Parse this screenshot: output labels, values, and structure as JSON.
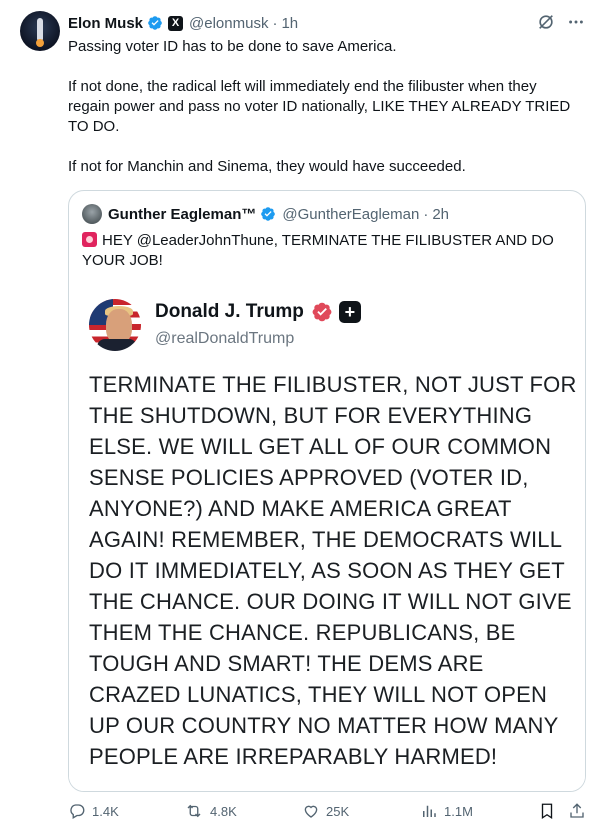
{
  "tweet": {
    "author_name": "Elon Musk",
    "handle": "@elonmusk",
    "separator": "·",
    "time": "1h",
    "paragraphs": [
      "Passing voter ID has to be done to save America.",
      "If not done, the radical left will immediately end the filibuster when they regain power and pass no voter ID nationally, LIKE THEY ALREADY TRIED TO DO.",
      "If not for Manchin and Sinema, they would have succeeded."
    ]
  },
  "quote": {
    "author_name": "Gunther Eagleman™",
    "handle": "@GuntherEagleman",
    "separator": "·",
    "time": "2h",
    "text": "HEY @LeaderJohnThune, TERMINATE THE FILIBUSTER AND DO YOUR JOB!",
    "image": {
      "name": "Donald J. Trump",
      "handle": "@realDonaldTrump",
      "plus_glyph": "+",
      "body": "TERMINATE THE FILIBUSTER, NOT JUST FOR THE SHUTDOWN, BUT FOR EVERYTHING ELSE. WE WILL GET ALL OF OUR COMMON SENSE POLICIES APPROVED (VOTER ID, ANYONE?) AND MAKE AMERICA GREAT AGAIN! REMEMBER, THE DEMOCRATS WILL DO IT IMMEDIATELY, AS SOON AS THEY GET THE CHANCE. OUR DOING IT WILL NOT GIVE THEM THE CHANCE. REPUBLICANS, BE TOUGH AND SMART! THE DEMS ARE CRAZED LUNATICS, THEY WILL NOT OPEN UP OUR COUNTRY NO MATTER HOW MANY PEOPLE ARE IRREPARABLY HARMED!"
    }
  },
  "actions": {
    "replies": "1.4K",
    "reposts": "4.8K",
    "likes": "25K",
    "views": "1.1M"
  },
  "icons": {
    "verified": "verified-badge-icon",
    "x_logo": "x-logo-icon",
    "grok": "grok-icon",
    "more": "more-icon",
    "siren": "siren-emoji-icon",
    "reply": "reply-icon",
    "repost": "repost-icon",
    "like": "heart-icon",
    "views": "views-icon",
    "bookmark": "bookmark-icon",
    "share": "share-icon"
  },
  "colors": {
    "verified_blue": "#1d9bf0",
    "secondary_text": "#536471",
    "border": "#cfd9de",
    "truth_badge_red": "#e0495a"
  }
}
